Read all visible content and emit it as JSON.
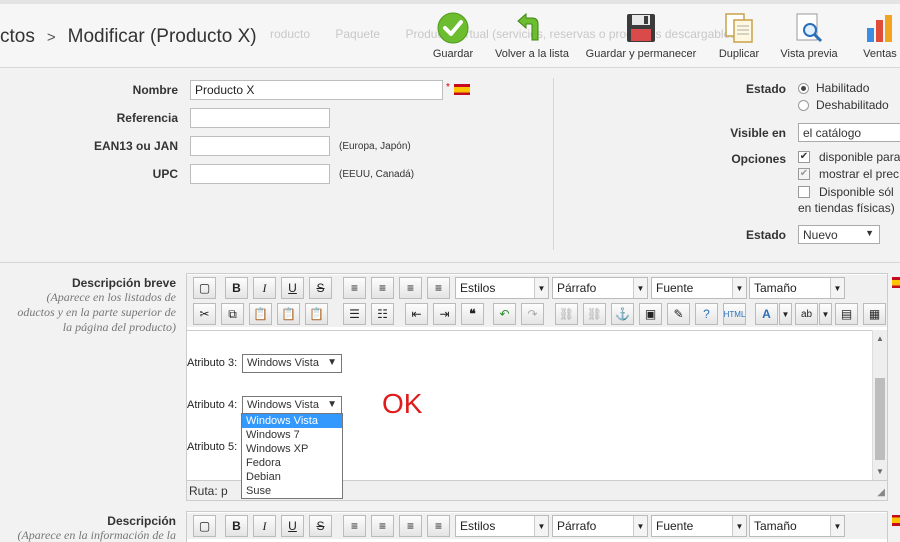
{
  "header": {
    "breadcrumb_parent": "ctos",
    "breadcrumb_separator": ">",
    "title": "Modificar (Producto X)",
    "ghost_options": [
      "roducto",
      "Paquete",
      "Producto virtual (servicios, reservas o productos descargables)"
    ],
    "actions": [
      {
        "label": "Guardar",
        "icon": "check-circle-icon"
      },
      {
        "label": "Volver a la lista",
        "icon": "back-arrow-icon"
      },
      {
        "label": "Guardar y permanecer",
        "icon": "floppy-disk-icon"
      },
      {
        "label": "Duplicar",
        "icon": "duplicate-icon"
      },
      {
        "label": "Vista previa",
        "icon": "preview-icon"
      },
      {
        "label": "Ventas",
        "icon": "bar-chart-icon"
      }
    ]
  },
  "form": {
    "name_label": "Nombre",
    "name_value": "Producto X",
    "required_mark": "*",
    "reference_label": "Referencia",
    "reference_value": "",
    "ean_label": "EAN13 ou JAN",
    "ean_value": "",
    "ean_hint": "(Europa, Japón)",
    "upc_label": "UPC",
    "upc_value": "",
    "upc_hint": "(EEUU, Canadá)"
  },
  "right_panel": {
    "estado_label": "Estado",
    "estado_options": [
      "Habilitado",
      "Deshabilitado"
    ],
    "visible_label": "Visible en",
    "visible_value": "el catálogo",
    "opciones_label": "Opciones",
    "options": [
      "disponible para",
      "mostrar el prec",
      "Disponible sól"
    ],
    "options_wrap": "en tiendas físicas)",
    "condition_label": "Estado",
    "condition_value": "Nuevo"
  },
  "short_desc": {
    "label": "Descripción breve",
    "help_line1": "(Aparece en los listados de",
    "help_line2": "oductos y en la parte superior de",
    "help_line3": "la página del producto)",
    "toolbar": {
      "styles": "Estilos",
      "format": "Párrafo",
      "font": "Fuente",
      "size": "Tamaño"
    },
    "attr3_label": "Atributo 3:",
    "attr3_value": "Windows Vista",
    "attr4_label": "Atributo 4:",
    "attr4_value": "Windows Vista",
    "attr5_label": "Atributo 5:",
    "dropdown_options": [
      "Windows Vista",
      "Windows 7",
      "Windows XP",
      "Fedora",
      "Debian",
      "Suse"
    ],
    "ok_text": "OK",
    "path_label": "Ruta: p"
  },
  "description": {
    "label": "Descripción",
    "help_line1": "(Aparece en la información de la"
  }
}
